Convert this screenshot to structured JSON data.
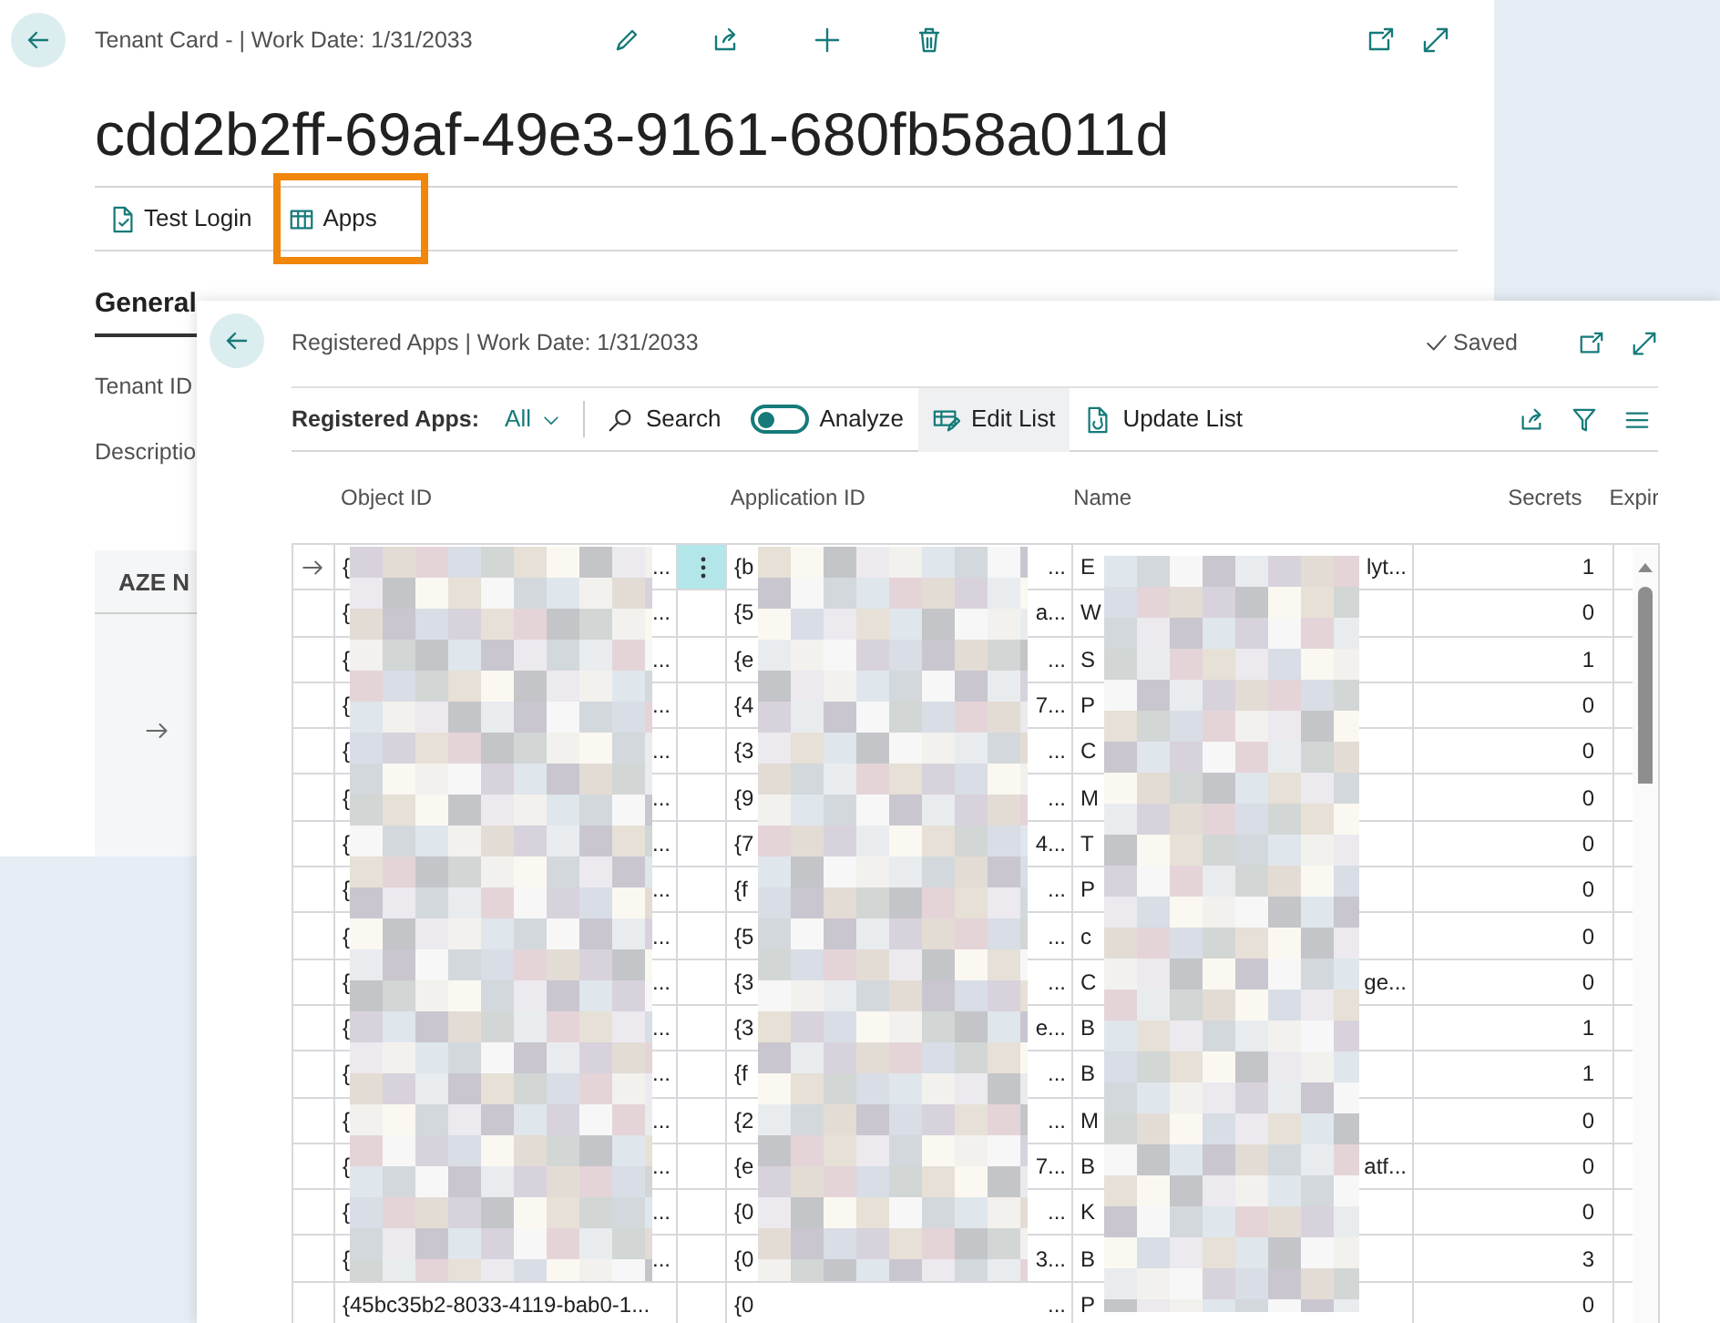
{
  "card": {
    "title": "Tenant Card - | Work Date: 1/31/2033",
    "heading": "cdd2b2ff-69af-49e3-9161-680fb58a011d",
    "actions": [
      {
        "kind": "doc",
        "label": "Test Login",
        "highlighted": false
      },
      {
        "kind": "table",
        "label": "Apps",
        "highlighted": true
      }
    ],
    "section": "General",
    "fields": [
      "Tenant ID",
      "Descriptio"
    ],
    "part_header": "AZE N"
  },
  "dialog": {
    "title": "Registered Apps | Work Date: 1/31/2033",
    "saved": "Saved",
    "toolbar": {
      "label": "Registered Apps:",
      "filter": "All",
      "items": [
        {
          "kind": "search",
          "label": "Search",
          "active": false
        },
        {
          "kind": "toggle",
          "label": "Analyze",
          "on": false
        },
        {
          "kind": "edit",
          "label": "Edit List",
          "active": true
        },
        {
          "kind": "update",
          "label": "Update List",
          "active": false
        }
      ]
    },
    "columns": [
      "Object ID",
      "Application ID",
      "Name",
      "Secrets",
      "Expir"
    ],
    "rows": [
      {
        "selected": true,
        "object_id": "{",
        "object_id_end": "...",
        "application_id": "{b",
        "application_id_end": "...",
        "name": "E",
        "name_end": "lyt...",
        "secrets": "1"
      },
      {
        "selected": false,
        "object_id": "{",
        "object_id_end": "...",
        "application_id": "{5",
        "application_id_end": "a...",
        "name": "W",
        "secrets": "0"
      },
      {
        "selected": false,
        "object_id": "{",
        "object_id_end": "...",
        "application_id": "{e",
        "application_id_end": "...",
        "name": "S",
        "secrets": "1"
      },
      {
        "selected": false,
        "object_id": "{",
        "object_id_end": "...",
        "application_id": "{4",
        "application_id_end": "7...",
        "name": "P",
        "secrets": "0"
      },
      {
        "selected": false,
        "object_id": "{",
        "object_id_end": "...",
        "application_id": "{3",
        "application_id_end": "...",
        "name": "C",
        "secrets": "0"
      },
      {
        "selected": false,
        "object_id": "{",
        "object_id_end": "...",
        "application_id": "{9",
        "application_id_end": "...",
        "name": "M",
        "secrets": "0"
      },
      {
        "selected": false,
        "object_id": "{",
        "object_id_end": "...",
        "application_id": "{7",
        "application_id_end": "4...",
        "name": "T",
        "secrets": "0"
      },
      {
        "selected": false,
        "object_id": "{",
        "object_id_end": "...",
        "application_id": "{f",
        "application_id_end": "...",
        "name": "P",
        "secrets": "0"
      },
      {
        "selected": false,
        "object_id": "{",
        "object_id_end": "...",
        "application_id": "{5",
        "application_id_end": "...",
        "name": "c",
        "secrets": "0"
      },
      {
        "selected": false,
        "object_id": "{",
        "object_id_end": "...",
        "application_id": "{3",
        "application_id_end": "...",
        "name": "C",
        "name_end": "ge...",
        "secrets": "0"
      },
      {
        "selected": false,
        "object_id": "{",
        "object_id_end": "...",
        "application_id": "{3",
        "application_id_end": "e...",
        "name": "B",
        "secrets": "1"
      },
      {
        "selected": false,
        "object_id": "{",
        "object_id_end": "...",
        "application_id": "{f",
        "application_id_end": "...",
        "name": "B",
        "secrets": "1"
      },
      {
        "selected": false,
        "object_id": "{",
        "object_id_end": "...",
        "application_id": "{2",
        "application_id_end": "...",
        "name": "M",
        "secrets": "0"
      },
      {
        "selected": false,
        "object_id": "{",
        "object_id_end": "...",
        "application_id": "{e",
        "application_id_end": "7...",
        "name": "B",
        "name_end": "atf...",
        "secrets": "0"
      },
      {
        "selected": false,
        "object_id": "{",
        "object_id_end": "...",
        "application_id": "{0",
        "application_id_end": "...",
        "name": "K",
        "secrets": "0"
      },
      {
        "selected": false,
        "object_id": "{",
        "object_id_end": "...",
        "application_id": "{0",
        "application_id_end": "3...",
        "name": "B",
        "secrets": "3"
      },
      {
        "selected": false,
        "object_id": "{45bc35b2-8033-4119-bab0-1...",
        "application_id": "{0",
        "application_id_end": "...",
        "name": "P",
        "secrets": "0"
      }
    ]
  }
}
